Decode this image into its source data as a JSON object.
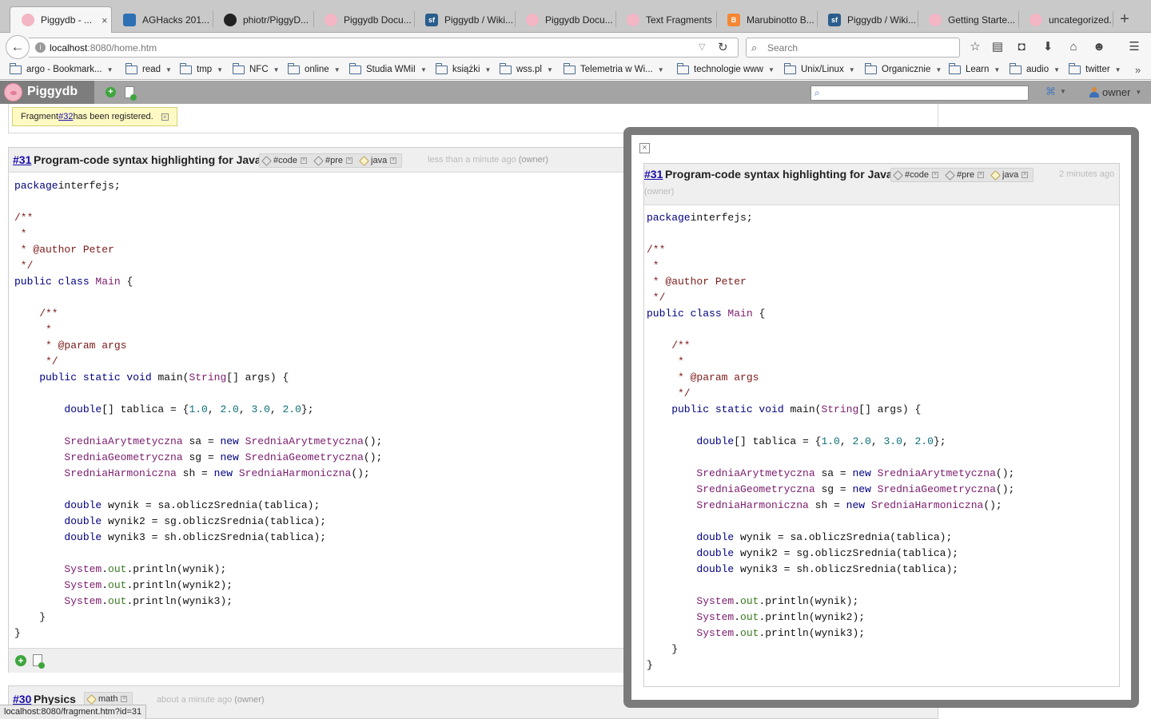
{
  "browser": {
    "tabs": [
      {
        "label": "Piggydb - ...",
        "icon": "pig-icon",
        "active": true
      },
      {
        "label": "AGHacks 201...",
        "icon": "trello-icon"
      },
      {
        "label": "phiotr/PiggyD...",
        "icon": "github-icon"
      },
      {
        "label": "Piggydb Docu...",
        "icon": "pig-icon"
      },
      {
        "label": "Piggydb / Wiki...",
        "icon": "sourceforge-icon"
      },
      {
        "label": "Piggydb Docu...",
        "icon": "pig-icon"
      },
      {
        "label": "Text Fragments",
        "icon": "pig-icon"
      },
      {
        "label": "Marubinotto B...",
        "icon": "blogger-icon"
      },
      {
        "label": "Piggydb / Wiki...",
        "icon": "sourceforge-icon"
      },
      {
        "label": "Getting Starte...",
        "icon": "pig-icon"
      },
      {
        "label": "uncategorized...",
        "icon": "pig-icon"
      }
    ],
    "close_glyph": "×",
    "new_tab_glyph": "+",
    "url_host": "localhost",
    "url_rest": ":8080/home.htm",
    "search_placeholder": "Search",
    "bookmarks": [
      {
        "label": "argo - Bookmark...",
        "caret": true
      },
      {
        "label": "read",
        "caret": true
      },
      {
        "label": "tmp",
        "caret": true
      },
      {
        "label": "NFC",
        "caret": true
      },
      {
        "label": "online",
        "caret": true
      },
      {
        "label": "Studia WMiI",
        "caret": true
      },
      {
        "label": "książki",
        "caret": true
      },
      {
        "label": "wss.pl",
        "caret": true
      },
      {
        "label": "Telemetria w Wi...",
        "caret": true
      },
      {
        "label": "technologie www",
        "caret": true
      },
      {
        "label": "Unix/Linux",
        "caret": true
      },
      {
        "label": "Organicznie",
        "caret": true
      },
      {
        "label": "Learn",
        "caret": true
      },
      {
        "label": "audio",
        "caret": true
      },
      {
        "label": "twitter",
        "caret": true
      }
    ],
    "status_url": "localhost:8080/fragment.htm?id=31"
  },
  "app": {
    "name": "Piggydb",
    "user": "owner"
  },
  "notice": {
    "prefix": "Fragment ",
    "link": "#32",
    "suffix": " has been registered."
  },
  "fragment": {
    "id": "#31",
    "title": "Program-code syntax highlighting for Java",
    "tags": [
      {
        "name": "#code",
        "icon": "tag-icon"
      },
      {
        "name": "#pre",
        "icon": "tag-icon"
      },
      {
        "name": "java",
        "icon": "tag-icon"
      }
    ],
    "time": "less than a minute ago",
    "owner": "(owner)"
  },
  "popup": {
    "id": "#31",
    "title": "Program-code syntax highlighting for Java",
    "time": "2 minutes ago",
    "owner": "(owner)"
  },
  "code": [
    [
      [
        "kw",
        "package"
      ],
      [
        "",
        "interfejs;"
      ]
    ],
    [],
    [
      [
        "cm",
        "/**"
      ]
    ],
    [
      [
        "cm",
        " *"
      ]
    ],
    [
      [
        "cm",
        " * @author Peter"
      ]
    ],
    [
      [
        "cm",
        " */"
      ]
    ],
    [
      [
        "kw",
        "public class "
      ],
      [
        "ty",
        "Main"
      ],
      [
        "",
        " {"
      ]
    ],
    [],
    [
      [
        "cm",
        "    /**"
      ]
    ],
    [
      [
        "cm",
        "     *"
      ]
    ],
    [
      [
        "cm",
        "     * @param args"
      ]
    ],
    [
      [
        "cm",
        "     */"
      ]
    ],
    [
      [
        "kw",
        "    public static void "
      ],
      [
        "",
        "main("
      ],
      [
        "ty",
        "String"
      ],
      [
        "",
        "[] args) {"
      ]
    ],
    [],
    [
      [
        "kw",
        "        double"
      ],
      [
        "",
        "[] tablica = {"
      ],
      [
        "nu",
        "1.0"
      ],
      [
        "",
        ", "
      ],
      [
        "nu",
        "2.0"
      ],
      [
        "",
        ", "
      ],
      [
        "nu",
        "3.0"
      ],
      [
        "",
        ", "
      ],
      [
        "nu",
        "2.0"
      ],
      [
        "",
        "};"
      ]
    ],
    [],
    [
      [
        "ty",
        "        SredniaArytmetyczna"
      ],
      [
        "",
        " sa = "
      ],
      [
        "kw",
        "new "
      ],
      [
        "ty",
        "SredniaArytmetyczna"
      ],
      [
        "",
        "();"
      ]
    ],
    [
      [
        "ty",
        "        SredniaGeometryczna"
      ],
      [
        "",
        " sg = "
      ],
      [
        "kw",
        "new "
      ],
      [
        "ty",
        "SredniaGeometryczna"
      ],
      [
        "",
        "();"
      ]
    ],
    [
      [
        "ty",
        "        SredniaHarmoniczna"
      ],
      [
        "",
        " sh = "
      ],
      [
        "kw",
        "new "
      ],
      [
        "ty",
        "SredniaHarmoniczna"
      ],
      [
        "",
        "();"
      ]
    ],
    [],
    [
      [
        "kw",
        "        double "
      ],
      [
        "",
        "wynik = sa.obliczSrednia(tablica);"
      ]
    ],
    [
      [
        "kw",
        "        double "
      ],
      [
        "",
        "wynik2 = sg.obliczSrednia(tablica);"
      ]
    ],
    [
      [
        "kw",
        "        double "
      ],
      [
        "",
        "wynik3 = sh.obliczSrednia(tablica);"
      ]
    ],
    [],
    [
      [
        "ty",
        "        System"
      ],
      [
        "",
        "."
      ],
      [
        "ob",
        "out"
      ],
      [
        "",
        ".println(wynik);"
      ]
    ],
    [
      [
        "ty",
        "        System"
      ],
      [
        "",
        "."
      ],
      [
        "ob",
        "out"
      ],
      [
        "",
        ".println(wynik2);"
      ]
    ],
    [
      [
        "ty",
        "        System"
      ],
      [
        "",
        "."
      ],
      [
        "ob",
        "out"
      ],
      [
        "",
        ".println(wynik3);"
      ]
    ],
    [
      [
        "",
        "    }"
      ]
    ],
    [
      [
        "",
        "}"
      ]
    ]
  ],
  "fragment2": {
    "id": "#30",
    "title": "Physics",
    "tag": "math",
    "time": "about a minute ago",
    "owner": "(owner)"
  }
}
